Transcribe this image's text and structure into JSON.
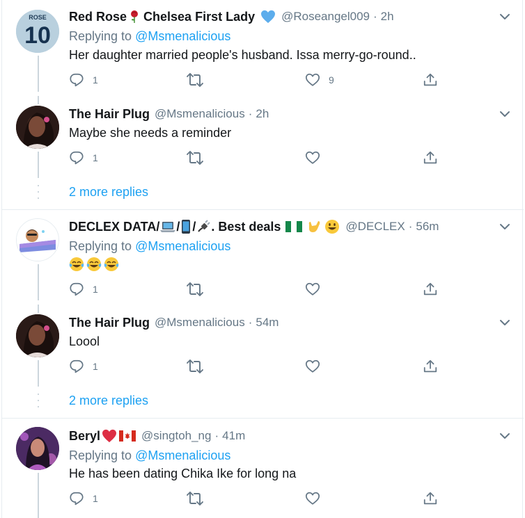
{
  "tweets": [
    {
      "name": "Red Rose",
      "name_tail": "Chelsea First Lady",
      "handle": "@Roseangel009",
      "sep": "·",
      "time": "2h",
      "replying_label": "Replying to",
      "replying_to": "@Msmenalicious",
      "text": "Her daughter married people's husband. Issa merry-go-round..",
      "reply_count": "1",
      "like_count": "9",
      "avatar_badge_top": "ROSE",
      "avatar_badge_num": "10"
    },
    {
      "name": "The Hair Plug",
      "handle": "@Msmenalicious",
      "sep": "·",
      "time": "2h",
      "text": "Maybe she needs a reminder",
      "reply_count": "1",
      "more_replies": "2 more replies"
    },
    {
      "name_part1": "DECLEX DATA/",
      "name_part2": "/",
      "name_part3": "/",
      "name_part4": ". Best deals",
      "handle": "@DECLEX",
      "sep": "·",
      "time": "56m",
      "replying_label": "Replying to",
      "replying_to": "@Msmenalicious",
      "reply_count": "1"
    },
    {
      "name": "The Hair Plug",
      "handle": "@Msmenalicious",
      "sep": "·",
      "time": "54m",
      "text": "Loool",
      "reply_count": "1",
      "more_replies": "2 more replies"
    },
    {
      "name": "Beryl",
      "handle": "@singtoh_ng",
      "sep": "·",
      "time": "41m",
      "replying_label": "Replying to",
      "replying_to": "@Msmenalicious",
      "text": "He has been dating Chika Ike for long na",
      "reply_count": "1"
    }
  ],
  "icons": {
    "reply": "reply-icon",
    "retweet": "retweet-icon",
    "like": "heart-icon",
    "share": "share-icon",
    "caret": "chevron-down-icon"
  },
  "colors": {
    "link": "#1da1f2",
    "secondary": "#657786",
    "border": "#e6ecf0",
    "thread": "#ccd6dd"
  }
}
